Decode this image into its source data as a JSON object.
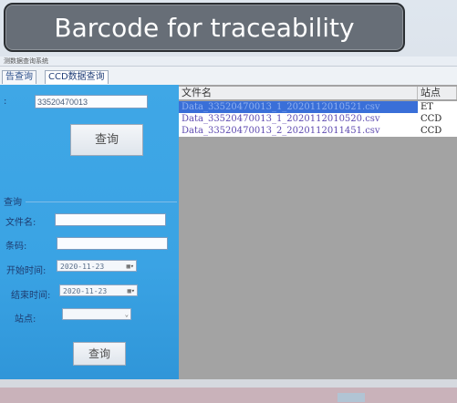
{
  "caption": "Barcode for traceability",
  "window": {
    "title": "测数据查询系统"
  },
  "tabs": [
    {
      "label": "告查询"
    },
    {
      "label": "CCD数据查询"
    }
  ],
  "barcode_query": {
    "value": "33520470013",
    "button_label": "查询"
  },
  "search_group": {
    "title": "查询",
    "filename_label": "文件名:",
    "barcode_label": "条码:",
    "start_time_label": "开始时间:",
    "start_time_value": "2020-11-23",
    "end_time_label": "结束时间:",
    "end_time_value": "2020-11-23",
    "station_label": "站点:",
    "button_label": "查询"
  },
  "file_table": {
    "columns": [
      "文件名",
      "站点"
    ],
    "rows": [
      {
        "file": "Data_33520470013_1_2020112010521.csv",
        "station": "ET",
        "selected": true
      },
      {
        "file": "Data_33520470013_1_2020112010520.csv",
        "station": "CCD",
        "selected": false
      },
      {
        "file": "Data_33520470013_2_2020112011451.csv",
        "station": "CCD",
        "selected": false
      }
    ]
  }
}
